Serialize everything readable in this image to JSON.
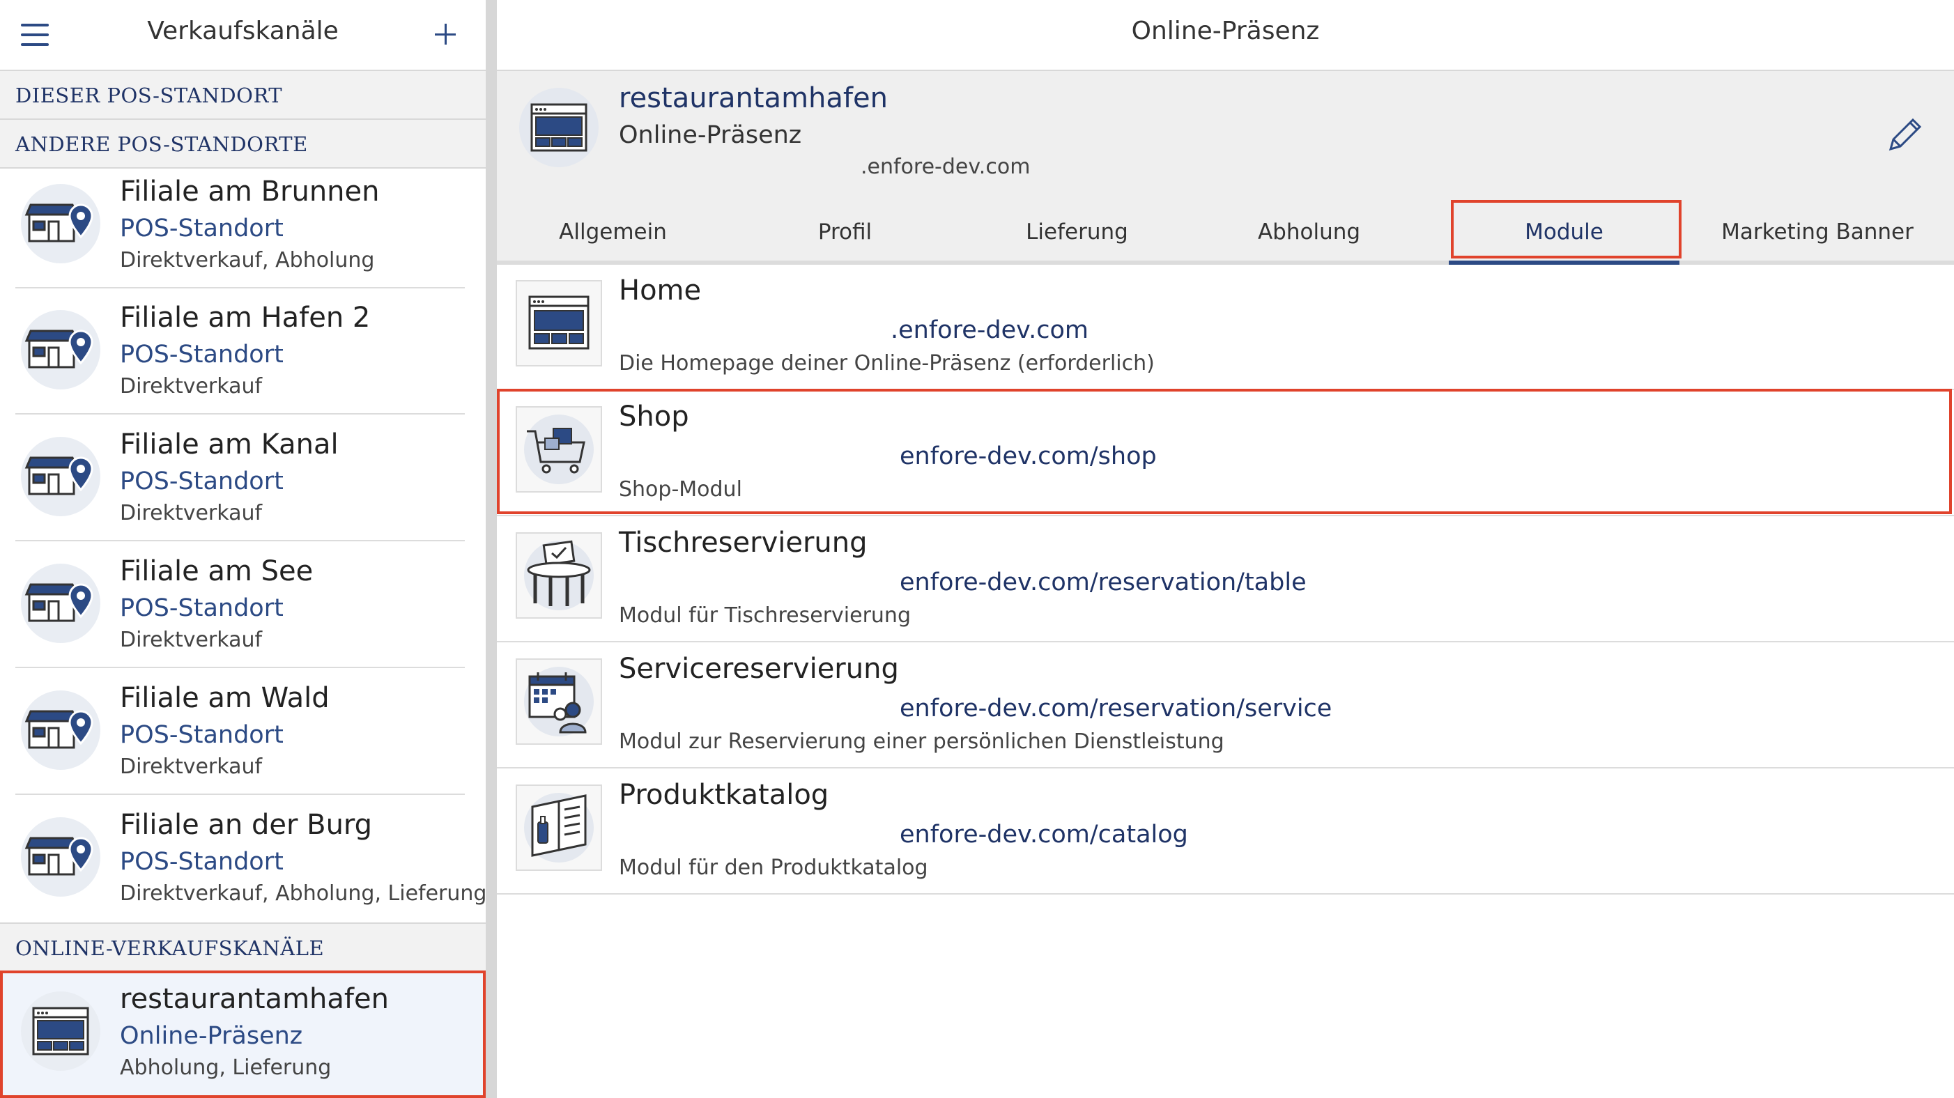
{
  "left_panel": {
    "title": "Verkaufskanäle",
    "sections": {
      "this_location": "DIESER POS-STANDORT",
      "other_locations": "ANDERE POS-STANDORTE",
      "online_channels": "ONLINE-VERKAUFSKANÄLE"
    },
    "locations": [
      {
        "name": "Filiale am Brunnen",
        "type": "POS-Standort",
        "services": "Direktverkauf, Abholung"
      },
      {
        "name": "Filiale am Hafen 2",
        "type": "POS-Standort",
        "services": "Direktverkauf"
      },
      {
        "name": "Filiale am Kanal",
        "type": "POS-Standort",
        "services": "Direktverkauf"
      },
      {
        "name": "Filiale am See",
        "type": "POS-Standort",
        "services": "Direktverkauf"
      },
      {
        "name": "Filiale am Wald",
        "type": "POS-Standort",
        "services": "Direktverkauf"
      },
      {
        "name": "Filiale an der Burg",
        "type": "POS-Standort",
        "services": "Direktverkauf, Abholung, Lieferung"
      }
    ],
    "online": {
      "name": "restaurantamhafen",
      "type": "Online-Präsenz",
      "services": "Abholung, Lieferung"
    }
  },
  "right_panel": {
    "title": "Online-Präsenz",
    "detail": {
      "name": "restaurantamhafen",
      "type": "Online-Präsenz",
      "domain": ".enfore-dev.com"
    },
    "tabs": [
      "Allgemein",
      "Profil",
      "Lieferung",
      "Abholung",
      "Module",
      "Marketing Banner"
    ],
    "active_tab": "Module",
    "modules": [
      {
        "title": "Home",
        "url": ".enfore-dev.com",
        "description": "Die Homepage deiner Online-Präsenz (erforderlich)",
        "icon": "browser-window-icon"
      },
      {
        "title": "Shop",
        "url": "enfore-dev.com/shop",
        "description": "Shop-Modul",
        "icon": "shopping-cart-icon"
      },
      {
        "title": "Tischreservierung",
        "url": "enfore-dev.com/reservation/table",
        "description": "Modul für Tischreservierung",
        "icon": "table-reservation-icon"
      },
      {
        "title": "Servicereservierung",
        "url": "enfore-dev.com/reservation/service",
        "description": "Modul zur Reservierung einer persönlichen Dienstleistung",
        "icon": "calendar-person-icon"
      },
      {
        "title": "Produktkatalog",
        "url": "enfore-dev.com/catalog",
        "description": "Modul für den Produktkatalog",
        "icon": "catalog-book-icon"
      }
    ]
  },
  "colors": {
    "accent": "#2c4a84",
    "highlight": "#e0432c",
    "panel_bg": "#efefef"
  }
}
